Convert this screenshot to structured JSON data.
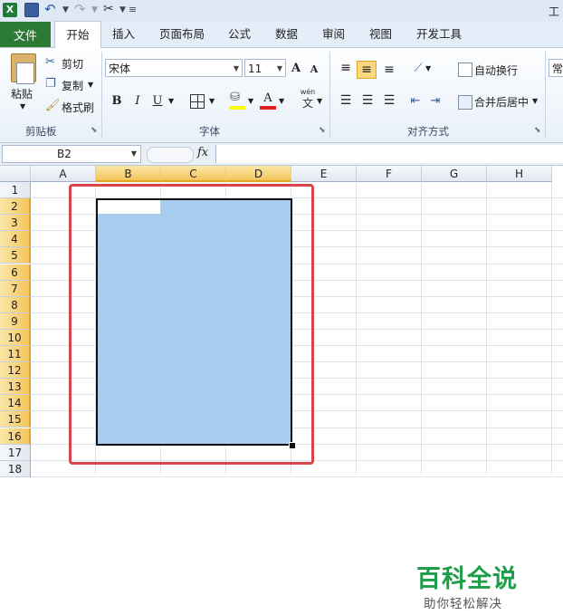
{
  "window": {
    "title_partial": "工"
  },
  "ribbon_tabs": [
    "文件",
    "开始",
    "插入",
    "页面布局",
    "公式",
    "数据",
    "审阅",
    "视图",
    "开发工具"
  ],
  "clipboard": {
    "paste": "粘贴",
    "cut": "剪切",
    "copy": "复制",
    "format_painter": "格式刷",
    "group": "剪贴板"
  },
  "font": {
    "name": "宋体",
    "size": "11",
    "bold": "B",
    "italic": "I",
    "underline": "U",
    "wen": "wén",
    "wen_char": "文",
    "group": "字体"
  },
  "alignment": {
    "wrap": "自动换行",
    "merge": "合并后居中",
    "group": "对齐方式",
    "number_partial": "常"
  },
  "formula_bar": {
    "name_box": "B2",
    "fx": "fx",
    "content": ""
  },
  "sheet": {
    "columns": [
      "A",
      "B",
      "C",
      "D",
      "E",
      "F",
      "G",
      "H"
    ],
    "rows": [
      "1",
      "2",
      "3",
      "4",
      "5",
      "6",
      "7",
      "8",
      "9",
      "10",
      "11",
      "12",
      "13",
      "14",
      "15",
      "16",
      "17",
      "18"
    ],
    "selected_columns": [
      "B",
      "C",
      "D"
    ],
    "selected_rows": [
      "2",
      "3",
      "4",
      "5",
      "6",
      "7",
      "8",
      "9",
      "10",
      "11",
      "12",
      "13",
      "14",
      "15",
      "16"
    ],
    "active_cell": "B2",
    "selection_range": "B2:D16"
  },
  "watermark": {
    "main": "百科全说",
    "sub": "助你轻松解决"
  },
  "colors": {
    "excel_green": "#2c7a34",
    "selection_fill": "#a8cdee",
    "highlight_box": "#d9454b",
    "watermark_green": "#1f9e4a"
  }
}
